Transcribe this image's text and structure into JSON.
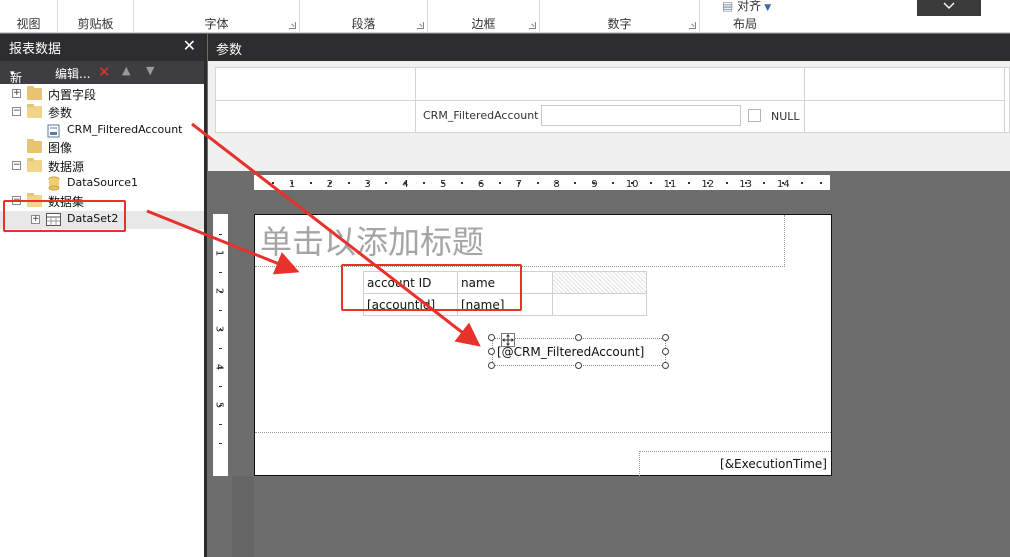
{
  "ribbon": {
    "groups": [
      "视图",
      "剪贴板",
      "字体",
      "段落",
      "边框",
      "数字",
      "布局"
    ],
    "align_label": "对齐"
  },
  "left_panel": {
    "title": "报表数据",
    "toolbar": {
      "new_label": "新建",
      "edit_label": "编辑..."
    },
    "tree": {
      "builtin_fields": "内置字段",
      "parameters": "参数",
      "param_item": "CRM_FilteredAccount",
      "images": "图像",
      "datasources": "数据源",
      "datasource_item": "DataSource1",
      "datasets": "数据集",
      "dataset_item": "DataSet2"
    }
  },
  "params_panel": {
    "title": "参数",
    "param_label": "CRM_FilteredAccount",
    "param_value": "",
    "null_label": "NULL",
    "null_checked": false
  },
  "ruler": {
    "horizontal": [
      "1",
      "2",
      "3",
      "4",
      "5",
      "6",
      "7",
      "8",
      "9",
      "10",
      "11",
      "12",
      "13",
      "14"
    ],
    "vertical": [
      "1",
      "2",
      "3",
      "4",
      "5"
    ]
  },
  "report": {
    "title_placeholder": "单击以添加标题",
    "table": {
      "headers": [
        "account ID",
        "name",
        ""
      ],
      "row": [
        "[accountid]",
        "[name]",
        ""
      ]
    },
    "param_expression": "[@CRM_FilteredAccount]",
    "execution_time": "[&ExecutionTime]"
  },
  "colors": {
    "panel_header": "#2d2d30",
    "annotation": "#e8312a",
    "folder": "#e8c470"
  }
}
